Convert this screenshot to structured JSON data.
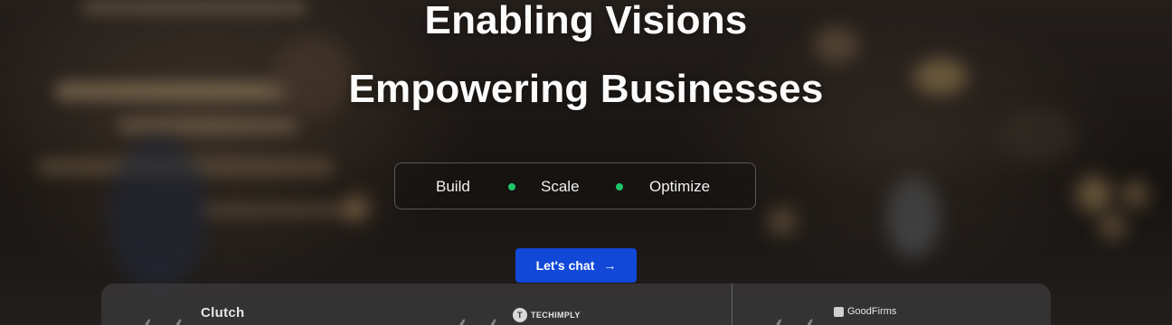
{
  "hero": {
    "headline_line1": "Enabling Visions",
    "headline_line2": "Empowering Businesses",
    "tagline": [
      "Build",
      "Scale",
      "Optimize"
    ],
    "dot_color": "#1fc46a",
    "cta": {
      "label": "Let's chat",
      "arrow": "→",
      "color": "#1148d8"
    }
  },
  "reviews": {
    "platforms": [
      {
        "name": "Clutch",
        "icon": "laurel-icon"
      },
      {
        "name": "TECHIMPLY",
        "icon": "techimply-logo-icon"
      },
      {
        "name": "GoodFirms",
        "icon": "goodfirms-logo-icon"
      }
    ],
    "laurel": "⸙ ⸙"
  }
}
